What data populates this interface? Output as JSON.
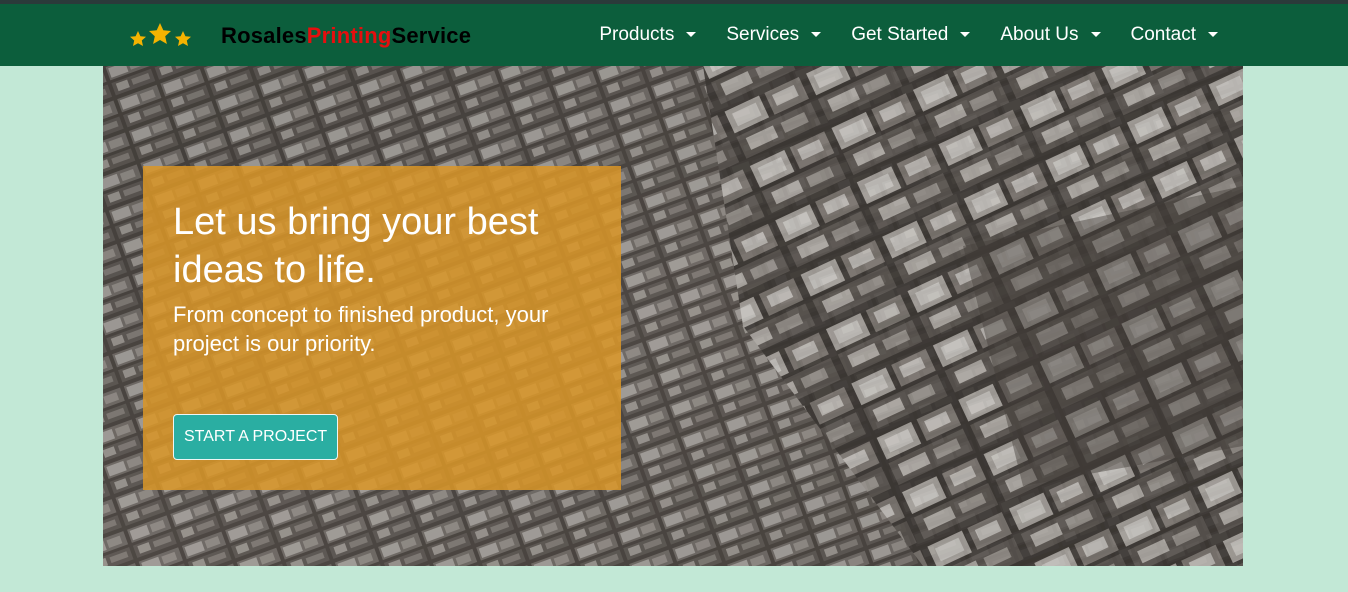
{
  "brand": {
    "part1": "Rosales",
    "part2": "Printing",
    "part3": "Service",
    "logo_icon": "three-stars-icon",
    "colors": {
      "accent": "#e60e0e",
      "stars": "#f5b301"
    }
  },
  "nav": {
    "items": [
      {
        "label": "Products"
      },
      {
        "label": "Services"
      },
      {
        "label": "Get Started"
      },
      {
        "label": "About Us"
      },
      {
        "label": "Contact"
      }
    ],
    "dropdown_icon": "caret-down-icon",
    "colors": {
      "bar": "#0c5e3c",
      "text": "#ffffff"
    }
  },
  "hero": {
    "background_image": "letterpress-type",
    "headline": "Let us bring your best ideas to life.",
    "subline": "From concept to finished product, your project is our priority.",
    "cta_label": "START A PROJECT",
    "colors": {
      "panel": "#da9628",
      "cta": "#2aaea2",
      "page": "#c2e8d6"
    }
  }
}
